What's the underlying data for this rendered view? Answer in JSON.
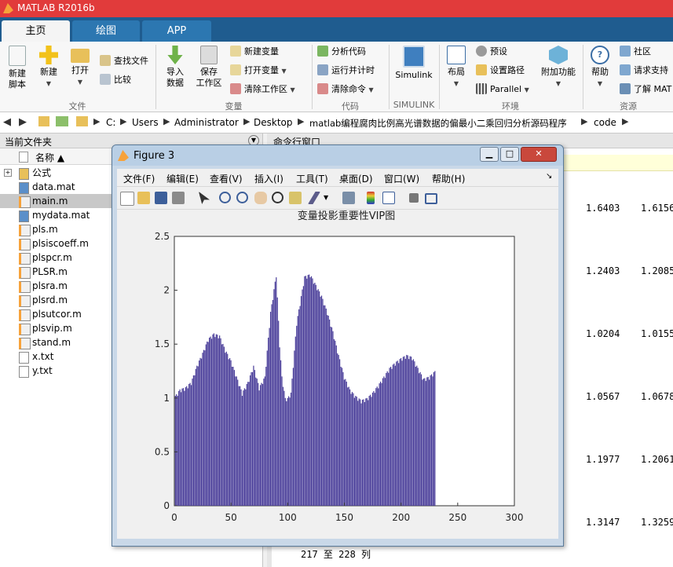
{
  "app": {
    "title": "MATLAB R2016b"
  },
  "tabs": [
    {
      "label": "主页"
    },
    {
      "label": "绘图"
    },
    {
      "label": "APP"
    }
  ],
  "ribbon": {
    "file": {
      "new_script": "新建\n脚本",
      "new": "新建",
      "open": "打开",
      "find_files": "查找文件",
      "compare": "比较",
      "group": "文件"
    },
    "variable": {
      "import": "导入\n数据",
      "save_ws": "保存\n工作区",
      "new_var": "新建变量",
      "open_var": "打开变量",
      "clear_ws": "清除工作区",
      "group": "变量"
    },
    "code": {
      "analyze": "分析代码",
      "run_time": "运行并计时",
      "clear_cmd": "清除命令",
      "group": "代码"
    },
    "simulink": {
      "label": "Simulink",
      "group": "SIMULINK"
    },
    "env": {
      "layout": "布局",
      "prefs": "预设",
      "set_path": "设置路径",
      "parallel": "Parallel",
      "addons": "附加功能",
      "group": "环境"
    },
    "resources": {
      "help": "帮助",
      "community": "社区",
      "request_support": "请求支持",
      "learn": "了解 MAT",
      "group": "资源"
    }
  },
  "address": {
    "crumbs": [
      "C:",
      "Users",
      "Administrator",
      "Desktop",
      "matlab编程腐肉比例高光谱数据的偏最小二乘回归分析源码程序",
      "code"
    ]
  },
  "current_folder": {
    "title": "当前文件夹",
    "col_name": "名称 ▲",
    "files": [
      {
        "name": "公式",
        "type": "folder"
      },
      {
        "name": "data.mat",
        "type": "mat"
      },
      {
        "name": "main.m",
        "type": "m",
        "selected": true
      },
      {
        "name": "mydata.mat",
        "type": "mat"
      },
      {
        "name": "pls.m",
        "type": "m"
      },
      {
        "name": "plsiscoeff.m",
        "type": "m"
      },
      {
        "name": "plspcr.m",
        "type": "m"
      },
      {
        "name": "PLSR.m",
        "type": "m"
      },
      {
        "name": "plsra.m",
        "type": "m"
      },
      {
        "name": "plsrd.m",
        "type": "m"
      },
      {
        "name": "plsutcor.m",
        "type": "m"
      },
      {
        "name": "plsvip.m",
        "type": "m"
      },
      {
        "name": "stand.m",
        "type": "m"
      },
      {
        "name": "x.txt",
        "type": "txt"
      },
      {
        "name": "y.txt",
        "type": "txt"
      }
    ]
  },
  "command_window": {
    "title": "命令行窗口",
    "rows": [
      {
        "a": "1.6403",
        "b": "1.6156"
      },
      {
        "a": "1.2403",
        "b": "1.2085"
      },
      {
        "a": "1.0204",
        "b": "1.0155"
      },
      {
        "a": "1.0567",
        "b": "1.0678"
      },
      {
        "a": "1.1977",
        "b": "1.2061"
      },
      {
        "a": "1.3147",
        "b": "1.3259"
      }
    ],
    "footer": "217 至 228 列"
  },
  "figure": {
    "title": "Figure 3",
    "menus": [
      "文件(F)",
      "编辑(E)",
      "查看(V)",
      "插入(I)",
      "工具(T)",
      "桌面(D)",
      "窗口(W)",
      "帮助(H)"
    ]
  },
  "chart_data": {
    "type": "bar",
    "title": "变量投影重要性VIP图",
    "xlabel": "",
    "ylabel": "",
    "xlim": [
      0,
      300
    ],
    "ylim": [
      0,
      2.5
    ],
    "xticks": [
      0,
      50,
      100,
      150,
      200,
      250,
      300
    ],
    "yticks": [
      0,
      0.5,
      1,
      1.5,
      2,
      2.5
    ],
    "bar_color": "#4b3f9a",
    "anchors_x": [
      1,
      5,
      10,
      15,
      20,
      25,
      30,
      35,
      40,
      45,
      50,
      55,
      60,
      65,
      70,
      75,
      80,
      85,
      90,
      93,
      95,
      98,
      100,
      103,
      108,
      115,
      120,
      125,
      130,
      135,
      140,
      145,
      150,
      155,
      160,
      165,
      170,
      175,
      180,
      185,
      190,
      195,
      200,
      205,
      210,
      215,
      220,
      225,
      230,
      235,
      240,
      245,
      250
    ],
    "anchors_y": [
      1.02,
      1.08,
      1.1,
      1.15,
      1.3,
      1.42,
      1.55,
      1.6,
      1.58,
      1.45,
      1.35,
      1.2,
      1.05,
      1.15,
      1.3,
      1.1,
      1.2,
      1.8,
      2.15,
      1.5,
      1.2,
      1.0,
      1.0,
      1.05,
      1.7,
      2.13,
      2.15,
      2.05,
      1.95,
      1.8,
      1.62,
      1.4,
      1.2,
      1.08,
      1.02,
      0.98,
      1.0,
      1.05,
      1.12,
      1.2,
      1.28,
      1.33,
      1.37,
      1.4,
      1.38,
      1.28,
      1.18,
      1.2,
      1.25
    ]
  }
}
